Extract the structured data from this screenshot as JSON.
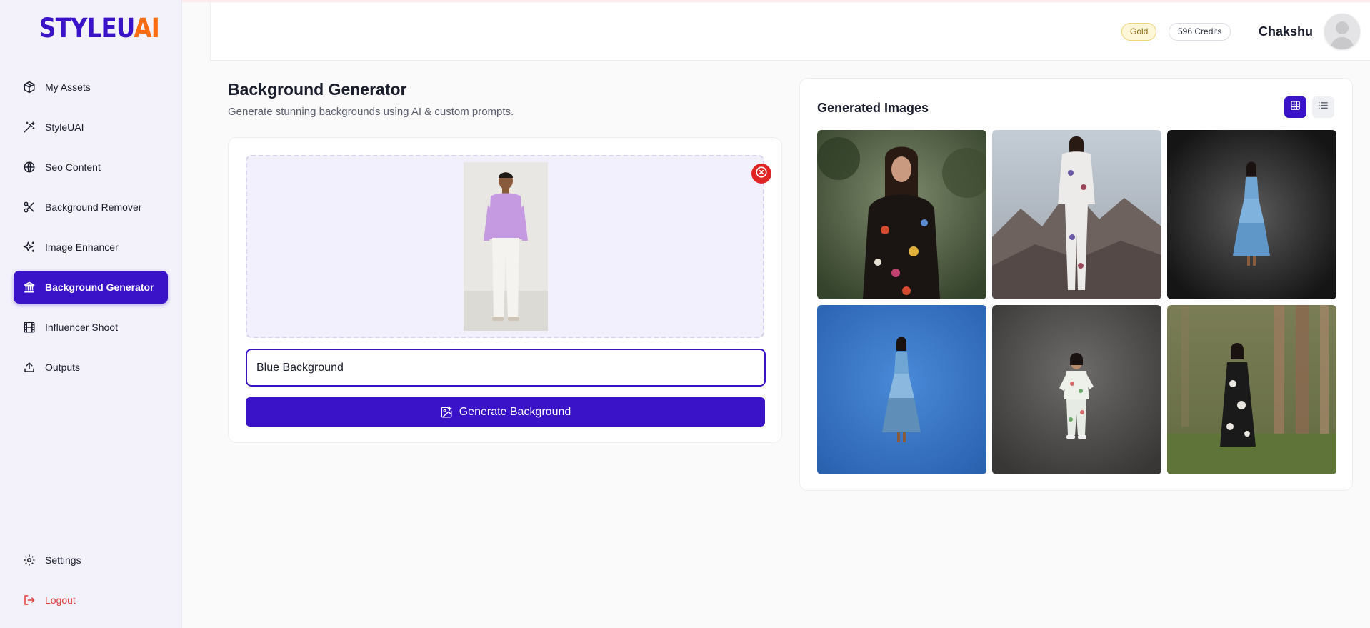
{
  "app": {
    "logo_part1": "STYLEU",
    "logo_part2": "AI",
    "brand_color": "#3a13c9",
    "accent_color": "#ff6b0f"
  },
  "sidebar": {
    "items": [
      {
        "label": "My Assets",
        "icon": "box-icon"
      },
      {
        "label": "StyleUAI",
        "icon": "magic-wand-icon"
      },
      {
        "label": "Seo Content",
        "icon": "globe-icon"
      },
      {
        "label": "Background Remover",
        "icon": "scissors-icon"
      },
      {
        "label": "Image Enhancer",
        "icon": "sparkles-icon"
      },
      {
        "label": "Background Generator",
        "icon": "landmark-icon",
        "active": true
      },
      {
        "label": "Influencer Shoot",
        "icon": "film-icon"
      },
      {
        "label": "Outputs",
        "icon": "upload-icon"
      }
    ],
    "bottom": {
      "settings_label": "Settings",
      "logout_label": "Logout"
    }
  },
  "header": {
    "plan_badge": "Gold",
    "credits_badge": "596 Credits",
    "username": "Chakshu"
  },
  "main": {
    "title": "Background Generator",
    "subtitle": "Generate stunning backgrounds using AI & custom prompts.",
    "prompt_value": "Blue Background",
    "generate_button": "Generate Background"
  },
  "gallery": {
    "title": "Generated Images",
    "view_mode": "grid",
    "images": [
      {
        "name": "generated-image-1",
        "bg": "#4a5a3a"
      },
      {
        "name": "generated-image-2",
        "bg": "#8a8f96"
      },
      {
        "name": "generated-image-3",
        "bg": "#1c1c1c"
      },
      {
        "name": "generated-image-4",
        "bg": "#3472c0"
      },
      {
        "name": "generated-image-5",
        "bg": "#4a4a4a"
      },
      {
        "name": "generated-image-6",
        "bg": "#6b6e48"
      }
    ]
  }
}
